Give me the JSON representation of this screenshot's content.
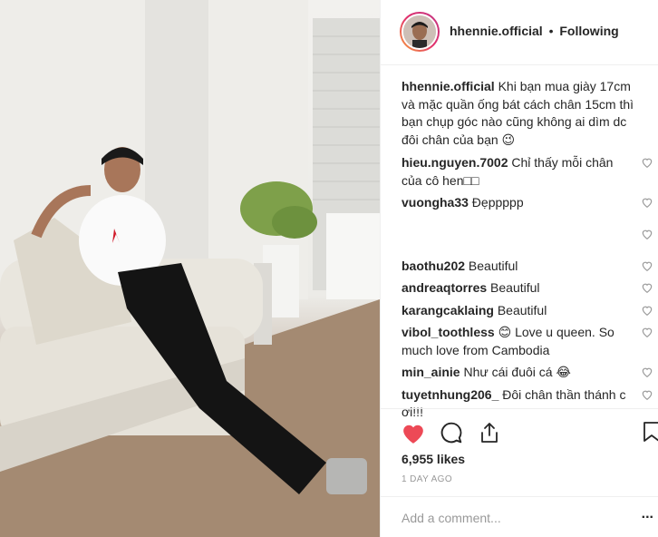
{
  "post": {
    "username": "hhennie.official",
    "separator": "•",
    "follow_status": "Following",
    "caption_user": "hhennie.official",
    "caption_text": "Khi bạn mua giày 17cm và mặc quần ống bát cách chân 15cm thì bạn chụp góc nào cũng không ai dìm dc đôi chân của bạn 😉",
    "likes": "6,955 likes",
    "time_ago": "1 DAY AGO",
    "comment_placeholder": "Add a comment...",
    "more_label": "..."
  },
  "comments": [
    {
      "user": "hieu.nguyen.7002",
      "text": "Chỉ thấy mỗi chân của cô hen□□"
    },
    {
      "user": "vuongha33",
      "text": "Đẹppppp"
    },
    {
      "user": "",
      "text": ""
    },
    {
      "user": "baothu202",
      "text": "Beautiful"
    },
    {
      "user": "andreaqtorres",
      "text": "Beautiful"
    },
    {
      "user": "karangcaklaing",
      "text": "Beautiful"
    },
    {
      "user": "vibol_toothless",
      "text": "😊             Love u queen. So much love from Cambodia"
    },
    {
      "user": "min_ainie",
      "text": "Như cái đuôi cá 😂"
    },
    {
      "user": "tuyetnhung206_",
      "text": "Đôi chân thần thánh c ơi!!!"
    }
  ],
  "colors": {
    "like_red": "#ed4956",
    "border": "#efefef",
    "muted": "#999999"
  },
  "icons": [
    "heart-icon",
    "comment-icon",
    "share-icon",
    "bookmark-icon"
  ]
}
